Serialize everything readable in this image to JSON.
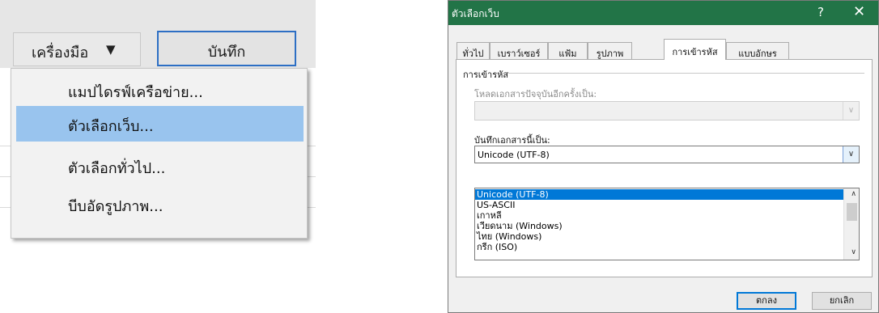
{
  "left": {
    "tools_label": "เครื่องมือ",
    "tools_arrow": "▼",
    "save_label": "บันทึก",
    "menu_items": [
      "แมปไดรฟ์เครือข่าย...",
      "ตัวเลือกเว็บ...",
      "ตัวเลือกทั่วไป...",
      "บีบอัดรูปภาพ..."
    ]
  },
  "dialog": {
    "title": "ตัวเลือกเว็บ",
    "help": "?",
    "close": "✕",
    "tabs": [
      "ทั่วไป",
      "เบราว์เซอร์",
      "แฟ้ม",
      "รูปภาพ",
      "การเข้ารหัส",
      "แบบอักษร"
    ],
    "active_tab": "การเข้ารหัส",
    "group_title": "การเข้ารหัส",
    "reload_label": "โหลดเอกสารปัจจุบันอีกครั้งเป็น:",
    "save_as_label": "บันทึกเอกสารนี้เป็น:",
    "save_as_value": "Unicode (UTF-8)",
    "encodings": [
      "Unicode (UTF-8)",
      "US-ASCII",
      "เกาหลี",
      "เวียดนาม (Windows)",
      "ไทย (Windows)",
      "กรีก (ISO)"
    ],
    "ok": "ตกลง",
    "cancel": "ยกเลิก"
  },
  "colors": {
    "titlebar": "#227447",
    "menu_highlight": "#99c4ee",
    "list_selection": "#0078d7",
    "save_border": "#2d6fc4"
  }
}
